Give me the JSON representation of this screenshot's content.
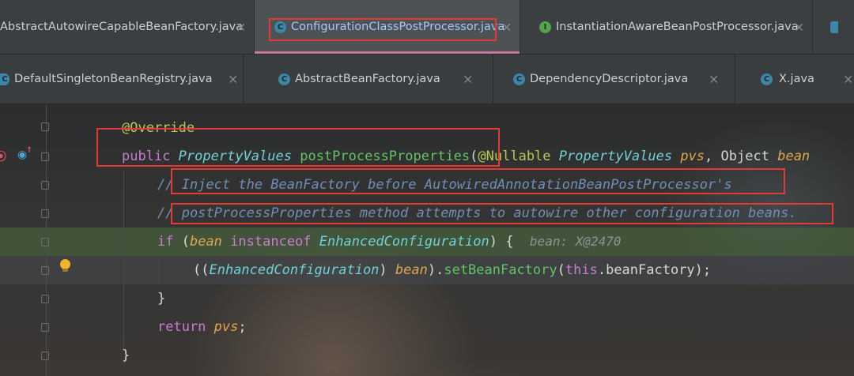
{
  "tabs_row1": [
    {
      "label": "AbstractAutowireCapableBeanFactory.java",
      "icon": "class-icon",
      "active": false
    },
    {
      "label": "ConfigurationClassPostProcessor.java",
      "icon": "class-icon",
      "active": true
    },
    {
      "label": "InstantiationAwareBeanPostProcessor.java",
      "icon": "interface-icon",
      "active": false
    }
  ],
  "tabs_row2": [
    {
      "label": "DefaultSingletonBeanRegistry.java",
      "icon": "class-icon"
    },
    {
      "label": "AbstractBeanFactory.java",
      "icon": "class-icon"
    },
    {
      "label": "DependencyDescriptor.java",
      "icon": "class-icon"
    },
    {
      "label": "X.java",
      "icon": "class-icon"
    }
  ],
  "icons": {
    "class": "C",
    "interface": "I",
    "close": "×"
  },
  "code": {
    "l1": {
      "annotation": "@Override"
    },
    "l2": {
      "kw": "public",
      "type": "PropertyValues",
      "method": "postProcessProperties",
      "paren": "(",
      "ann": "@Nullable",
      "type2": "PropertyValues",
      "param": "pvs",
      "comma": ",",
      "type3": "Object",
      "param2": "bean"
    },
    "l3": {
      "comment": "// Inject the BeanFactory before AutowiredAnnotationBeanPostProcessor's"
    },
    "l4": {
      "comment": "// postProcessProperties method attempts to autowire other configuration beans."
    },
    "l5": {
      "kw": "if",
      "open": " (",
      "param": "bean",
      "kw2": "instanceof",
      "type": "EnhancedConfiguration",
      "close": ") {",
      "hint": "bean: X@2470"
    },
    "l6": {
      "open": "((",
      "type": "EnhancedConfiguration",
      "close": ") ",
      "param": "bean",
      "mid": ").",
      "method": "setBeanFactory",
      "p2": "(",
      "kw": "this",
      "rest": ".beanFactory);"
    },
    "l7": {
      "text": "}"
    },
    "l8": {
      "kw": "return",
      "param": "pvs",
      "semi": ";"
    },
    "l9": {
      "text": "}"
    }
  }
}
